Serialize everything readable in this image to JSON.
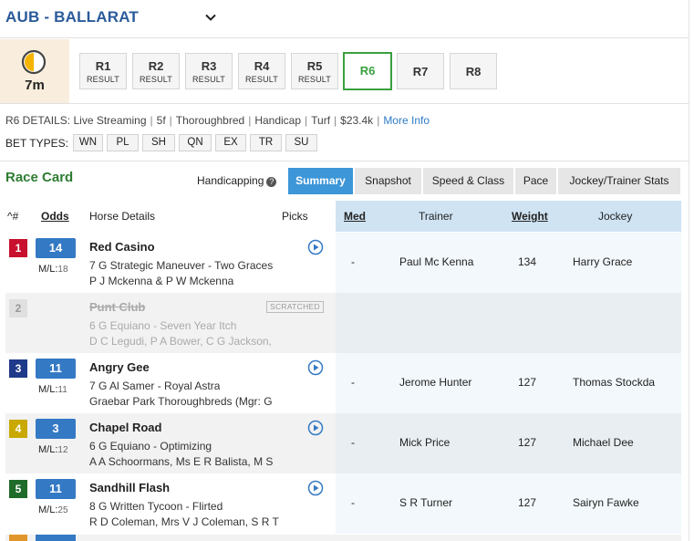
{
  "header": {
    "venue": "AUB - BALLARAT",
    "chevron_icon": "chevron-down-icon"
  },
  "timer": {
    "icon": "clock-half-icon",
    "text": "7m"
  },
  "races": [
    {
      "label": "R1",
      "status": "RESULT"
    },
    {
      "label": "R2",
      "status": "RESULT"
    },
    {
      "label": "R3",
      "status": "RESULT"
    },
    {
      "label": "R4",
      "status": "RESULT"
    },
    {
      "label": "R5",
      "status": "RESULT"
    },
    {
      "label": "R6",
      "status": ""
    },
    {
      "label": "R7",
      "status": ""
    },
    {
      "label": "R8",
      "status": ""
    }
  ],
  "active_race": "R6",
  "details": {
    "label": "R6 DETAILS:",
    "items": [
      "Live Streaming",
      "5f",
      "Thoroughbred",
      "Handicap",
      "Turf",
      "$23.4k"
    ],
    "more_info": "More Info"
  },
  "bet_types": {
    "label": "BET TYPES:",
    "items": [
      "WN",
      "PL",
      "SH",
      "QN",
      "EX",
      "TR",
      "SU"
    ]
  },
  "race_card": {
    "title": "Race Card",
    "handicapping_label": "Handicapping",
    "help_glyph": "?",
    "tabs": [
      "Summary",
      "Snapshot",
      "Speed & Class",
      "Pace",
      "Jockey/Trainer Stats"
    ],
    "active_tab": "Summary"
  },
  "columns": {
    "num": "^#",
    "odds": "Odds",
    "horse": "Horse Details",
    "picks": "Picks",
    "med": "Med",
    "trainer": "Trainer",
    "weight": "Weight",
    "jockey": "Jockey"
  },
  "runners": [
    {
      "num": "1",
      "num_color": "#c8102e",
      "odds": "14",
      "ml_label": "M/L:",
      "ml": "18",
      "name": "Red Casino",
      "line2": "7 G Strategic Maneuver - Two Graces",
      "line3": "P J Mckenna & P W Mckenna",
      "scratched": false,
      "med": "-",
      "trainer": "Paul Mc Kenna",
      "weight": "134",
      "jockey": "Harry Grace"
    },
    {
      "num": "2",
      "num_color": "#e0e0e0",
      "odds": "",
      "ml_label": "",
      "ml": "",
      "name": "Punt Club",
      "line2": "6 G Equiano - Seven Year Itch",
      "line3": "D C Legudi, P A Bower, C G Jackson,",
      "scratched": true,
      "scratched_label": "SCRATCHED",
      "med": "",
      "trainer": "",
      "weight": "",
      "jockey": ""
    },
    {
      "num": "3",
      "num_color": "#1f3a8a",
      "odds": "11",
      "ml_label": "M/L:",
      "ml": "11",
      "name": "Angry Gee",
      "line2": "7 G Al Samer - Royal Astra",
      "line3": "Graebar Park Thoroughbreds (Mgr: G",
      "scratched": false,
      "med": "-",
      "trainer": "Jerome Hunter",
      "weight": "127",
      "jockey": "Thomas Stockda"
    },
    {
      "num": "4",
      "num_color": "#c9a800",
      "odds": "3",
      "ml_label": "M/L:",
      "ml": "12",
      "name": "Chapel Road",
      "line2": "6 G Equiano - Optimizing",
      "line3": "A A Schoormans, Ms E R Balista, M S",
      "scratched": false,
      "med": "-",
      "trainer": "Mick Price",
      "weight": "127",
      "jockey": "Michael Dee"
    },
    {
      "num": "5",
      "num_color": "#1e6b2a",
      "odds": "11",
      "ml_label": "M/L:",
      "ml": "25",
      "name": "Sandhill Flash",
      "line2": "8 G Written Tycoon - Flirted",
      "line3": "R D Coleman, Mrs V J Coleman, S R T",
      "scratched": false,
      "med": "-",
      "trainer": "S R Turner",
      "weight": "127",
      "jockey": "Sairyn Fawke"
    }
  ]
}
